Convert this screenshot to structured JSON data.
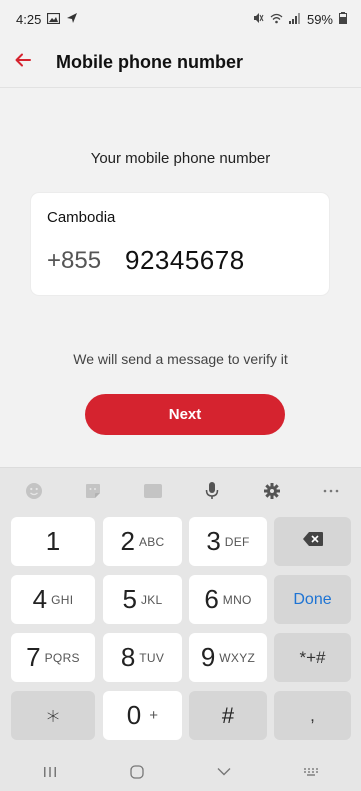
{
  "status_bar": {
    "time": "4:25",
    "battery": "59%",
    "left_icons": [
      "gallery-icon",
      "send-icon"
    ],
    "right_icons": [
      "mute-icon",
      "wifi-icon",
      "signal-icon",
      "battery-icon"
    ]
  },
  "header": {
    "back_icon": "arrow-left-icon",
    "title": "Mobile phone number"
  },
  "form": {
    "prompt": "Your mobile phone number",
    "country": "Cambodia",
    "country_code": "+855",
    "phone_number": "92345678",
    "verify_note": "We will send a message to verify it",
    "next_label": "Next"
  },
  "keyboard": {
    "toolbar_icons": [
      "emoji-icon",
      "sticker-icon",
      "gif-icon",
      "mic-icon",
      "settings-icon",
      "more-icon"
    ],
    "gif_label": "GIF",
    "keys": {
      "k1": "1",
      "k2": "2",
      "k2_sub": "ABC",
      "k3": "3",
      "k3_sub": "DEF",
      "k4": "4",
      "k4_sub": "GHI",
      "k5": "5",
      "k5_sub": "JKL",
      "k6": "6",
      "k6_sub": "MNO",
      "k7": "7",
      "k7_sub": "PQRS",
      "k8": "8",
      "k8_sub": "TUV",
      "k9": "9",
      "k9_sub": "WXYZ",
      "star": "∗",
      "k0": "0",
      "k0_sub": "+",
      "hash": "#",
      "comma": ",",
      "symbols": "*+#",
      "done": "Done"
    }
  },
  "navbar": {
    "icons": [
      "recents-icon",
      "home-icon",
      "back-chevron-icon",
      "keyboard-switch-icon"
    ]
  },
  "colors": {
    "accent": "#d5232f",
    "done_blue": "#1e74d4",
    "background": "#f2f2f2",
    "keyboard_bg": "#e6e6e6"
  }
}
